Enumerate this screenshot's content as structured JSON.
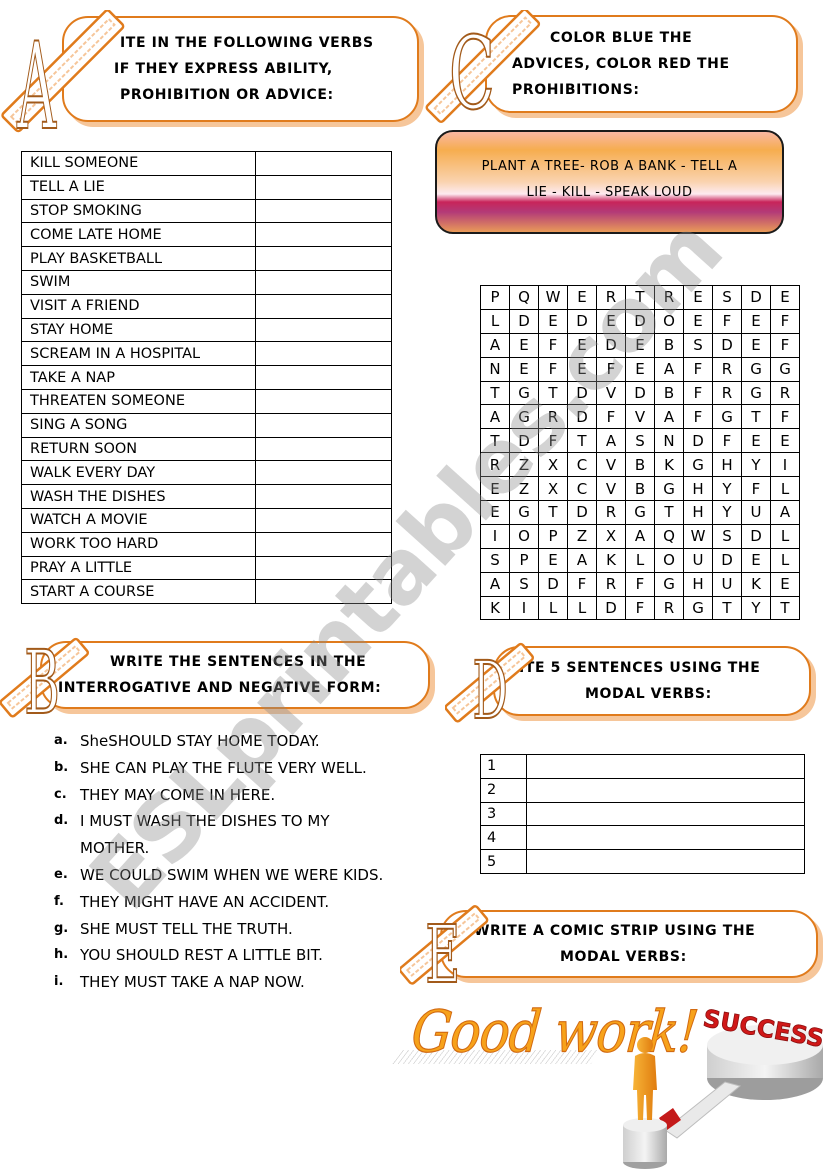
{
  "section_a": {
    "letter": "A",
    "instruction_lines": [
      "ITE IN THE FOLLOWING VERBS",
      "IF THEY EXPRESS ABILITY,",
      "PROHIBITION OR ADVICE:"
    ],
    "verbs": [
      "KILL SOMEONE",
      "TELL A LIE",
      "STOP SMOKING",
      "COME LATE HOME",
      "PLAY BASKETBALL",
      "SWIM",
      "VISIT A FRIEND",
      "STAY HOME",
      "SCREAM IN A HOSPITAL",
      "TAKE A NAP",
      "THREATEN SOMEONE",
      "SING A SONG",
      "RETURN SOON",
      "WALK EVERY DAY",
      "WASH THE DISHES",
      "WATCH A MOVIE",
      "WORK TOO HARD",
      "PRAY A LITTLE",
      "START A COURSE"
    ]
  },
  "section_c": {
    "letter": "C",
    "instruction_lines": [
      "COLOR BLUE THE",
      "ADVICES, COLOR RED THE",
      "PROHIBITIONS:"
    ],
    "word_box_lines": [
      "PLANT A TREE- ROB A BANK - TELL A",
      "LIE - KILL - SPEAK LOUD"
    ],
    "word_search": [
      [
        "P",
        "Q",
        "W",
        "E",
        "R",
        "T",
        "R",
        "E",
        "S",
        "D",
        "E"
      ],
      [
        "L",
        "D",
        "E",
        "D",
        "E",
        "D",
        "O",
        "E",
        "F",
        "E",
        "F"
      ],
      [
        "A",
        "E",
        "F",
        "E",
        "D",
        "E",
        "B",
        "S",
        "D",
        "E",
        "F"
      ],
      [
        "N",
        "E",
        "F",
        "E",
        "F",
        "E",
        "A",
        "F",
        "R",
        "G",
        "G"
      ],
      [
        "T",
        "G",
        "T",
        "D",
        "V",
        "D",
        "B",
        "F",
        "R",
        "G",
        "R"
      ],
      [
        "A",
        "G",
        "R",
        "D",
        "F",
        "V",
        "A",
        "F",
        "G",
        "T",
        "F"
      ],
      [
        "T",
        "D",
        "F",
        "T",
        "A",
        "S",
        "N",
        "D",
        "F",
        "E",
        "E"
      ],
      [
        "R",
        "Z",
        "X",
        "C",
        "V",
        "B",
        "K",
        "G",
        "H",
        "Y",
        "I"
      ],
      [
        "E",
        "Z",
        "X",
        "C",
        "V",
        "B",
        "G",
        "H",
        "Y",
        "F",
        "L"
      ],
      [
        "E",
        "G",
        "T",
        "D",
        "R",
        "G",
        "T",
        "H",
        "Y",
        "U",
        "A"
      ],
      [
        "I",
        "O",
        "P",
        "Z",
        "X",
        "A",
        "Q",
        "W",
        "S",
        "D",
        "L"
      ],
      [
        "S",
        "P",
        "E",
        "A",
        "K",
        "L",
        "O",
        "U",
        "D",
        "E",
        "L"
      ],
      [
        "A",
        "S",
        "D",
        "F",
        "R",
        "F",
        "G",
        "H",
        "U",
        "K",
        "E"
      ],
      [
        "K",
        "I",
        "L",
        "L",
        "D",
        "F",
        "R",
        "G",
        "T",
        "Y",
        "T"
      ]
    ]
  },
  "section_b": {
    "letter": "B",
    "instruction_lines": [
      "WRITE THE SENTENCES IN THE",
      "INTERROGATIVE AND NEGATIVE FORM:"
    ],
    "sentences": [
      {
        "marker": "a.",
        "text": "SheSHOULD STAY HOME TODAY."
      },
      {
        "marker": "b.",
        "text": "SHE CAN PLAY THE FLUTE VERY WELL."
      },
      {
        "marker": "c.",
        "text": "THEY MAY COME IN HERE."
      },
      {
        "marker": "d.",
        "text": "I MUST WASH THE DISHES TO MY MOTHER."
      },
      {
        "marker": "e.",
        "text": "WE COULD SWIM WHEN WE WERE KIDS."
      },
      {
        "marker": "f.",
        "text": "THEY MIGHT HAVE AN ACCIDENT."
      },
      {
        "marker": "g.",
        "text": "SHE MUST TELL THE TRUTH."
      },
      {
        "marker": "h.",
        "text": "YOU SHOULD REST A LITTLE BIT."
      },
      {
        "marker": "i.",
        "text": "THEY MUST TAKE A NAP NOW."
      }
    ]
  },
  "section_d": {
    "letter": "D",
    "instruction_lines": [
      "ITE 5 SENTENCES USING THE",
      "MODAL VERBS:"
    ],
    "rows": [
      "1",
      "2",
      "3",
      "4",
      "5"
    ]
  },
  "section_e": {
    "letter": "E",
    "instruction_lines": [
      "WRITE A COMIC STRIP USING THE",
      "MODAL VERBS:"
    ]
  },
  "footer": {
    "good_work": "Good work!",
    "success_label": "SUCCESS"
  },
  "watermark": "ESLprintables.com",
  "colors": {
    "accent_orange": "#e07b1c",
    "shadow_orange": "#f6c69a",
    "success_red": "#d01818",
    "figure_orange": "#f39a1e"
  }
}
